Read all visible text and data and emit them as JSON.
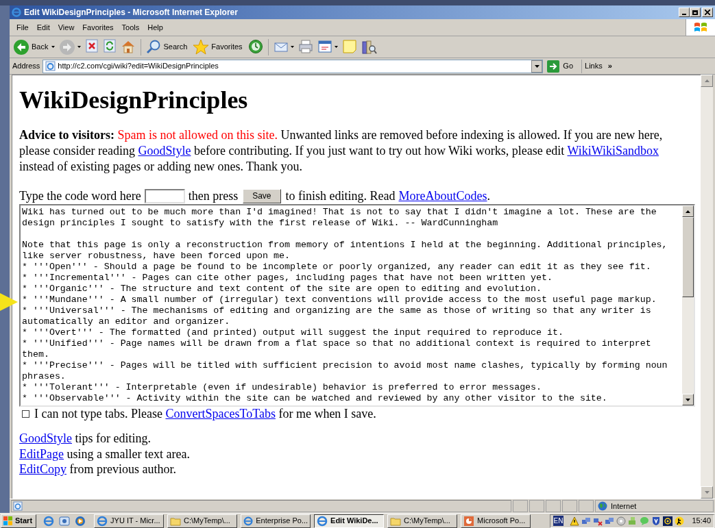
{
  "window": {
    "title": "Edit WikiDesignPrinciples - Microsoft Internet Explorer"
  },
  "menu": [
    "File",
    "Edit",
    "View",
    "Favorites",
    "Tools",
    "Help"
  ],
  "toolbar_groups": [
    {
      "items": [
        {
          "kind": "back",
          "label": "Back",
          "dropdown": true
        },
        {
          "kind": "forward",
          "dropdown": true
        },
        {
          "kind": "stop",
          "dropdown": false
        },
        {
          "kind": "refresh",
          "dropdown": false
        },
        {
          "kind": "home",
          "dropdown": false
        }
      ]
    },
    {
      "items": [
        {
          "kind": "search",
          "label": "Search",
          "dropdown": false
        },
        {
          "kind": "favorites",
          "label": "Favorites",
          "dropdown": false
        },
        {
          "kind": "history",
          "dropdown": false
        }
      ]
    },
    {
      "items": [
        {
          "kind": "mail",
          "dropdown": true
        },
        {
          "kind": "print",
          "dropdown": false
        },
        {
          "kind": "edit",
          "dropdown": true
        },
        {
          "kind": "note",
          "dropdown": false
        },
        {
          "kind": "research",
          "dropdown": false
        }
      ]
    }
  ],
  "address": {
    "label": "Address",
    "url": "http://c2.com/cgi/wiki?edit=WikiDesignPrinciples",
    "go": "Go",
    "links": "Links",
    "links_more": "»"
  },
  "page": {
    "heading": "WikiDesignPrinciples",
    "advice": [
      {
        "kind": "bold",
        "text": "Advice to visitors: "
      },
      {
        "kind": "alert",
        "text": "Spam is not allowed on this site."
      },
      {
        "kind": "text",
        "text": " Unwanted links are removed before indexing is allowed. If you are new here, please consider reading "
      },
      {
        "kind": "link",
        "text": "GoodStyle"
      },
      {
        "kind": "text",
        "text": " before contributing. If you just want to try out how Wiki works, please edit "
      },
      {
        "kind": "link",
        "text": "WikiWikiSandbox"
      },
      {
        "kind": "text",
        "text": " instead of existing pages or adding new ones. Thank you."
      }
    ],
    "code_line": [
      {
        "kind": "text",
        "text": "Type the code word here"
      },
      {
        "kind": "input"
      },
      {
        "kind": "text",
        "text": "then press"
      },
      {
        "kind": "button",
        "text": "Save"
      },
      {
        "kind": "text",
        "text": "to finish editing. Read"
      },
      {
        "kind": "link",
        "text": "MoreAboutCodes"
      },
      {
        "kind": "text",
        "text": "."
      }
    ],
    "editor": {
      "text": "Wiki has turned out to be much more than I'd imagined! That is not to say that I didn't imagine a lot. These are the\ndesign principles I sought to satisfy with the first release of Wiki. -- WardCunningham\n\nNote that this page is only a reconstruction from memory of intentions I held at the beginning. Additional principles,\nlike server robustness, have been forced upon me.\n* '''Open''' - Should a page be found to be incomplete or poorly organized, any reader can edit it as they see fit.\n* '''Incremental''' - Pages can cite other pages, including pages that have not been written yet.\n* '''Organic''' - The structure and text content of the site are open to editing and evolution.\n* '''Mundane''' - A small number of (irregular) text conventions will provide access to the most useful page markup.\n* '''Universal''' - The mechanisms of editing and organizing are the same as those of writing so that any writer is\nautomatically an editor and organizer.\n* '''Overt''' - The formatted (and printed) output will suggest the input required to reproduce it.\n* '''Unified''' - Page names will be drawn from a flat space so that no additional context is required to interpret\nthem.\n* '''Precise''' - Pages will be titled with sufficient precision to avoid most name clashes, typically by forming noun\nphrases.\n* '''Tolerant''' - Interpretable (even if undesirable) behavior is preferred to error messages.\n* '''Observable''' - Activity within the site can be watched and reviewed by any other visitor to the site."
    },
    "tabs_option": {
      "checked": false,
      "parts": [
        {
          "kind": "text",
          "text": "I can not type tabs. Please "
        },
        {
          "kind": "link",
          "text": "ConvertSpacesToTabs"
        },
        {
          "kind": "text",
          "text": " for me when I save."
        }
      ]
    },
    "help_links": [
      {
        "link": "GoodStyle",
        "text": " tips for editing."
      },
      {
        "link": "EditPage",
        "text": " using a smaller text area."
      },
      {
        "link": "EditCopy",
        "text": " from previous author."
      }
    ]
  },
  "status_bar": {
    "zone": "Internet"
  },
  "taskbar": {
    "start": "Start",
    "tasks": [
      {
        "kind": "ie",
        "label": "JYU IT - Micr...",
        "selected": false
      },
      {
        "kind": "folder",
        "label": "C:\\MyTemp\\...",
        "selected": false
      },
      {
        "kind": "ie",
        "label": "Enterprise Po...",
        "selected": false
      },
      {
        "kind": "ie",
        "label": "Edit WikiDe...",
        "selected": true
      },
      {
        "kind": "folder",
        "label": "C:\\MyTemp\\...",
        "selected": false
      },
      {
        "kind": "powerpoint",
        "label": "Microsoft Po...",
        "selected": false
      }
    ],
    "language": "EN",
    "clock": "15:40"
  }
}
